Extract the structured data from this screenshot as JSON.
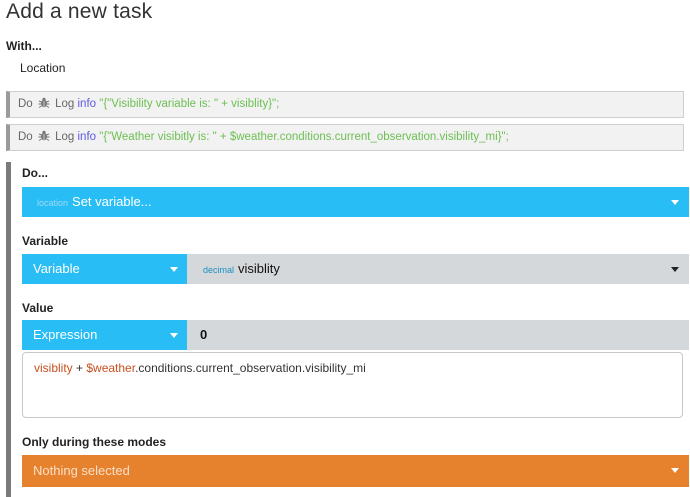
{
  "page": {
    "title": "Add a new task"
  },
  "with": {
    "label": "With...",
    "value": "Location"
  },
  "log_rows": [
    {
      "do": "Do",
      "icon": "bug-icon",
      "log": "Log",
      "level": "info",
      "text_open": "\"{\"Visibility variable is: \" + ",
      "var": "visiblity",
      "text_close": "}\";"
    },
    {
      "do": "Do",
      "icon": "bug-icon",
      "log": "Log",
      "level": "info",
      "text_open": "\"{\"Weather visibitly is: \" + ",
      "var": "$weather.conditions.current_observation.visibility_mi",
      "text_close": "}\";"
    }
  ],
  "do_section": {
    "label": "Do...",
    "action": {
      "tag": "location",
      "value": "Set variable..."
    },
    "variable_label": "Variable",
    "variable_type": "Variable",
    "variable_value": {
      "tag": "decimal",
      "value": "visiblity"
    },
    "value_label": "Value",
    "value_type": "Expression",
    "value_current": "0",
    "expression": {
      "var1": "visiblity",
      "op": " + ",
      "var2": "$weather",
      "rest": ".conditions.current_observation.visibility_mi"
    },
    "modes_label": "Only during these modes",
    "modes_value": "Nothing selected"
  },
  "colors": {
    "blue": "#29bdf5",
    "orange": "#e6812e",
    "gray": "#d5d8da",
    "log_green": "#6dbf53",
    "log_info": "#5a5adf"
  }
}
